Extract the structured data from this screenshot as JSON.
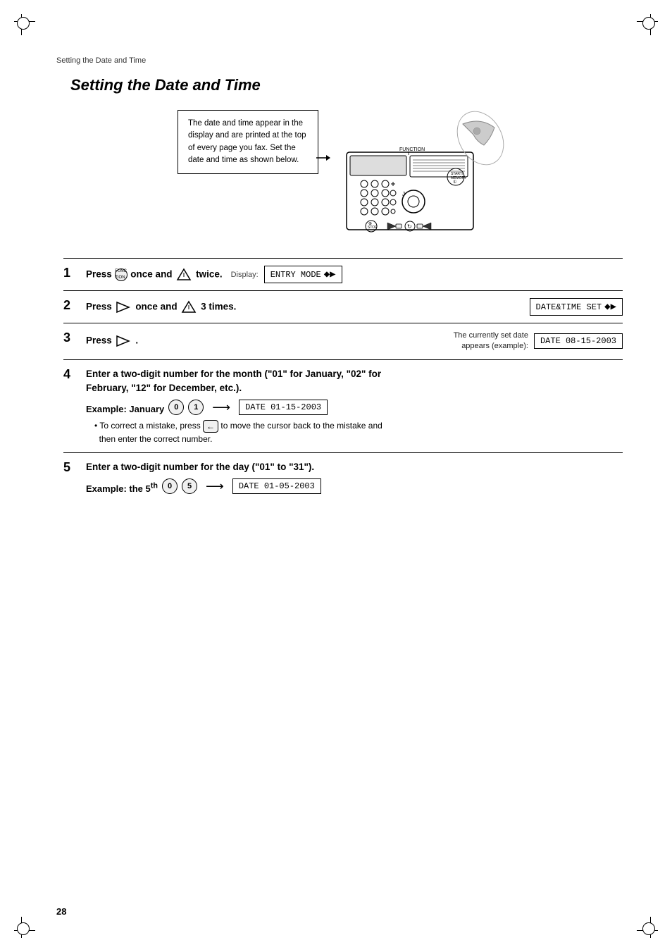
{
  "breadcrumb": "Setting the Date and Time",
  "page_title": "Setting the Date and Time",
  "callout_text": "The date and time appear in the display and are printed at the top of every page you fax. Set the date and time as shown below.",
  "steps": [
    {
      "number": "1",
      "text_parts": [
        "Press ",
        "FUNCTION",
        " once and ",
        "↑",
        " twice."
      ],
      "display_label": "Display:",
      "display_value": "ENTRY MODE",
      "display_has_arrow": true
    },
    {
      "number": "2",
      "text_parts": [
        "Press ",
        "→",
        " once and ",
        "↑",
        " 3 times."
      ],
      "display_value": "DATE&TIME SET",
      "display_has_arrow": true
    },
    {
      "number": "3",
      "text_parts": [
        "Press ",
        "→",
        "."
      ],
      "currently_label": "The currently set date\nappears (example):",
      "display_value": "DATE 08-15-2003"
    },
    {
      "number": "4",
      "text_main": "Enter a two-digit number for the month (\"01\" for January, \"02\" for\nFebruary, \"12\" for December, etc.).",
      "example_label": "Example: January",
      "example_keys": [
        "0",
        "1"
      ],
      "display_value": "DATE 01-15-2003",
      "note": "• To correct a mistake, press   to move the cursor back to the mistake and then enter the correct number."
    },
    {
      "number": "5",
      "text_main": "Enter a two-digit number for the day (\"01\" to \"31\").",
      "example_label": "Example: the 5",
      "example_sup": "th",
      "example_keys": [
        "0",
        "5"
      ],
      "display_value": "DATE 01-05-2003"
    }
  ],
  "page_number": "28",
  "labels": {
    "function_key": "FUNCTION",
    "start_memory": "START/\nMEMORY",
    "stop": "STOP",
    "display_arrow": "◆▶",
    "press": "Press"
  }
}
